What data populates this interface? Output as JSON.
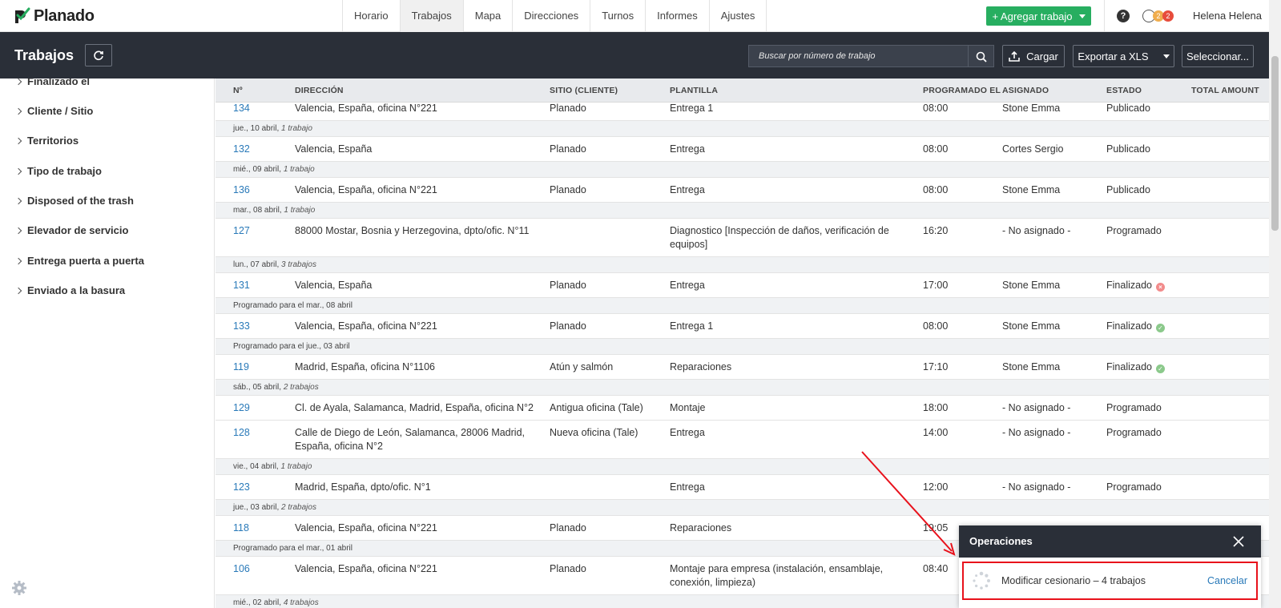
{
  "app": {
    "name": "Planado"
  },
  "nav": {
    "tabs": [
      "Horario",
      "Trabajos",
      "Mapa",
      "Direcciones",
      "Turnos",
      "Informes",
      "Ajustes"
    ],
    "add_job_label": "+ Agregar trabajo",
    "help_label": "?",
    "notif_orange": "2",
    "notif_red": "2",
    "user_name": "Helena Helena"
  },
  "header": {
    "title": "Trabajos",
    "search_placeholder": "Buscar por número de trabajo",
    "upload_label": "Cargar",
    "export_label": "Exportar a XLS",
    "select_label": "Seleccionar..."
  },
  "sidebar": {
    "items": [
      "Finalizado el",
      "Cliente / Sitio",
      "Territorios",
      "Tipo de trabajo",
      "Disposed of the trash",
      "Elevador de servicio",
      "Entrega puerta a puerta",
      "Enviado a la basura"
    ]
  },
  "table": {
    "headers": [
      "Nº",
      "DIRECCIÓN",
      "SITIO (CLIENTE)",
      "PLANTILLA",
      "PROGRAMADO EL",
      "ASIGNADO",
      "ESTADO",
      "TOTAL AMOUNT"
    ],
    "rows": [
      {
        "type": "job",
        "num": "134",
        "address": "Valencia, España, oficina N°221",
        "site": "Planado",
        "template": "Entrega 1",
        "time": "08:00",
        "assignee": "Stone Emma",
        "status": "Publicado",
        "icon": ""
      },
      {
        "type": "group",
        "date": "jue., 10 abril,",
        "count": "1 trabajo"
      },
      {
        "type": "job",
        "num": "132",
        "address": "Valencia, España",
        "site": "Planado",
        "template": "Entrega",
        "time": "08:00",
        "assignee": "Cortes Sergio",
        "status": "Publicado",
        "icon": ""
      },
      {
        "type": "group",
        "date": "mié., 09 abril,",
        "count": "1 trabajo"
      },
      {
        "type": "job",
        "num": "136",
        "address": "Valencia, España, oficina N°221",
        "site": "Planado",
        "template": "Entrega",
        "time": "08:00",
        "assignee": "Stone Emma",
        "status": "Publicado",
        "icon": ""
      },
      {
        "type": "group",
        "date": "mar., 08 abril,",
        "count": "1 trabajo"
      },
      {
        "type": "job",
        "num": "127",
        "address": "88000 Mostar, Bosnia y Herzegovina, dpto/ofic. N°11",
        "site": "",
        "template": "Diagnostico [Inspección de daños, verificación de equipos]",
        "time": "16:20",
        "assignee": "- No asignado -",
        "status": "Programado",
        "icon": "",
        "tall": true
      },
      {
        "type": "group",
        "date": "lun., 07 abril,",
        "count": "3 trabajos"
      },
      {
        "type": "job",
        "num": "131",
        "address": "Valencia, España",
        "site": "Planado",
        "template": "Entrega",
        "time": "17:00",
        "assignee": "Stone Emma",
        "status": "Finalizado",
        "icon": "red"
      },
      {
        "type": "sched",
        "text": "Programado para el mar., 08 abril"
      },
      {
        "type": "job",
        "num": "133",
        "address": "Valencia, España, oficina N°221",
        "site": "Planado",
        "template": "Entrega 1",
        "time": "08:00",
        "assignee": "Stone Emma",
        "status": "Finalizado",
        "icon": "green"
      },
      {
        "type": "sched",
        "text": "Programado para el jue., 03 abril"
      },
      {
        "type": "job",
        "num": "119",
        "address": "Madrid, España, oficina N°1106",
        "site": "Atún y salmón",
        "template": "Reparaciones",
        "time": "17:10",
        "assignee": "Stone Emma",
        "status": "Finalizado",
        "icon": "green"
      },
      {
        "type": "group",
        "date": "sáb., 05 abril,",
        "count": "2 trabajos"
      },
      {
        "type": "job",
        "num": "129",
        "address": "Cl. de Ayala, Salamanca, Madrid, España, oficina N°2",
        "site": "Antigua oficina (Tale)",
        "template": "Montaje",
        "time": "18:00",
        "assignee": "- No asignado -",
        "status": "Programado",
        "icon": ""
      },
      {
        "type": "job",
        "num": "128",
        "address": "Calle de Diego de León, Salamanca, 28006 Madrid, España, oficina N°2",
        "site": "Nueva oficina (Tale)",
        "template": "Entrega",
        "time": "14:00",
        "assignee": "- No asignado -",
        "status": "Programado",
        "icon": "",
        "tall": true
      },
      {
        "type": "group",
        "date": "vie., 04 abril,",
        "count": "1 trabajo"
      },
      {
        "type": "job",
        "num": "123",
        "address": "Madrid, España, dpto/ofic. N°1",
        "site": "",
        "template": "Entrega",
        "time": "12:00",
        "assignee": "- No asignado -",
        "status": "Programado",
        "icon": ""
      },
      {
        "type": "group",
        "date": "jue., 03 abril,",
        "count": "2 trabajos"
      },
      {
        "type": "job",
        "num": "118",
        "address": "Valencia, España, oficina N°221",
        "site": "Planado",
        "template": "Reparaciones",
        "time": "19:05",
        "assignee": "",
        "status": "",
        "icon": ""
      },
      {
        "type": "sched",
        "text": "Programado para el mar., 01 abril"
      },
      {
        "type": "job",
        "num": "106",
        "address": "Valencia, España, oficina N°221",
        "site": "Planado",
        "template": "Montaje para empresa (instalación, ensamblaje, conexión, limpieza)",
        "time": "08:40",
        "assignee": "",
        "status": "",
        "icon": "",
        "tall": true
      },
      {
        "type": "group",
        "date": "mié., 02 abril,",
        "count": "4 trabajos"
      }
    ]
  },
  "operations": {
    "title": "Operaciones",
    "task": "Modificar cesionario – 4 trabajos",
    "cancel_label": "Cancelar"
  },
  "colors": {
    "accent_green": "#27ae60",
    "dark_header": "#2a2f38",
    "link_blue": "#2a7ab9",
    "annotation_red": "#e8111b"
  }
}
